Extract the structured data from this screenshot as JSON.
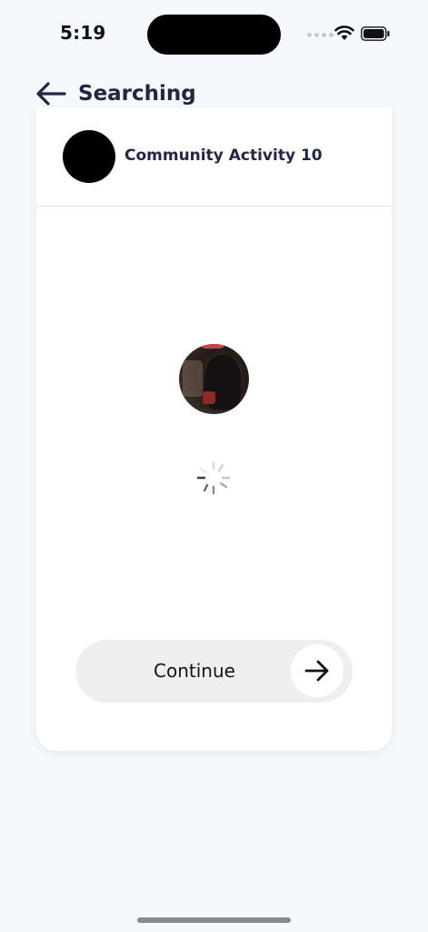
{
  "status_bar": {
    "time": "5:19"
  },
  "header": {
    "title": "Searching",
    "back_icon": "arrow-left-icon"
  },
  "activity": {
    "name": "Community Activity 10"
  },
  "continue_button": {
    "label": "Continue",
    "icon": "arrow-right-icon"
  },
  "colors": {
    "background": "#f5f8fd",
    "card": "#ffffff",
    "title_text": "#222643",
    "button_bg": "#efefef"
  }
}
